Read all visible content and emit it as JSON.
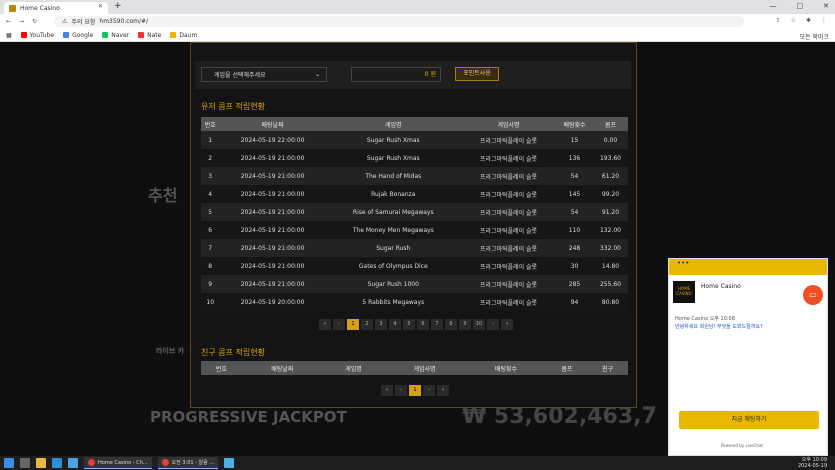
{
  "browser": {
    "tab_title": "Home Casino",
    "url_prefix": "주의 요함",
    "url": "hm3590.com/#/"
  },
  "bookmarks": [
    {
      "label": "YouTube",
      "color": "#ff0000"
    },
    {
      "label": "Google",
      "color": "#4285f4"
    },
    {
      "label": "Naver",
      "color": "#03c75a"
    },
    {
      "label": "Nate",
      "color": "#ee3333"
    },
    {
      "label": "Daum",
      "color": "#f0b400"
    }
  ],
  "bookmarks_right": "모든 북마크",
  "filters": {
    "game_select": "게임을 선택해주세요",
    "amount": "0 원",
    "point_button": "포인트사용"
  },
  "user_comp": {
    "title": "유저 콤프 적립현황",
    "headers": [
      "번호",
      "배팅날짜",
      "게임명",
      "게임사명",
      "배팅횟수",
      "콤프"
    ],
    "rows": [
      [
        "1",
        "2024-05-19 22:00:00",
        "Sugar Rush Xmas",
        "프라그마틱플레이 슬롯",
        "15",
        "0.00"
      ],
      [
        "2",
        "2024-05-19 21:00:00",
        "Sugar Rush Xmas",
        "프라그마틱플레이 슬롯",
        "136",
        "193.60"
      ],
      [
        "3",
        "2024-05-19 21:00:00",
        "The Hand of Midas",
        "프라그마틱플레이 슬롯",
        "54",
        "61.20"
      ],
      [
        "4",
        "2024-05-19 21:00:00",
        "Rujak Bonanza",
        "프라그마틱플레이 슬롯",
        "145",
        "99.20"
      ],
      [
        "5",
        "2024-05-19 21:00:00",
        "Rise of Samurai Megaways",
        "프라그마틱플레이 슬롯",
        "54",
        "91.20"
      ],
      [
        "6",
        "2024-05-19 21:00:00",
        "The Money Men Megaways",
        "프라그마틱플레이 슬롯",
        "110",
        "132.00"
      ],
      [
        "7",
        "2024-05-19 21:00:00",
        "Sugar Rush",
        "프라그마틱플레이 슬롯",
        "248",
        "332.00"
      ],
      [
        "8",
        "2024-05-19 21:00:00",
        "Gates of Olympus Dice",
        "프라그마틱플레이 슬롯",
        "30",
        "14.80"
      ],
      [
        "9",
        "2024-05-19 21:00:00",
        "Sugar Rush 1000",
        "프라그마틱플레이 슬롯",
        "285",
        "255.60"
      ],
      [
        "10",
        "2024-05-19 20:00:00",
        "5 Rabbits Megaways",
        "프라그마틱플레이 슬롯",
        "94",
        "80.80"
      ]
    ],
    "pages": [
      "«",
      "‹",
      "1",
      "2",
      "3",
      "4",
      "5",
      "6",
      "7",
      "8",
      "9",
      "10",
      "›",
      "»"
    ]
  },
  "friend_comp": {
    "title": "친구 콤프 적립현황",
    "headers": [
      "번호",
      "배팅날짜",
      "게임명",
      "게임사명",
      "배팅횟수",
      "콤프",
      "친구"
    ],
    "pages": [
      "«",
      "‹",
      "1",
      "›",
      "»"
    ]
  },
  "background": {
    "jackpot": "PROGRESSIVE JACKPOT",
    "amount": "₩ 53,602,463,7",
    "live_label": "라이브 카",
    "rec": "추천"
  },
  "chat": {
    "brand": "Home Casino",
    "logo_text": "HOME CASINO",
    "time_line": "Home Casino 오후 10:08",
    "message": "안녕하세요 회원님! 무엇을 도와드릴까요?",
    "button": "지금 채팅하기",
    "powered": "Powered by LiveChat"
  },
  "taskbar": {
    "task1": "Home Casino - Ch...",
    "task2": "오전 3:01 - 알람 ...",
    "time": "오후 10:09",
    "date": "2024-05-19"
  }
}
